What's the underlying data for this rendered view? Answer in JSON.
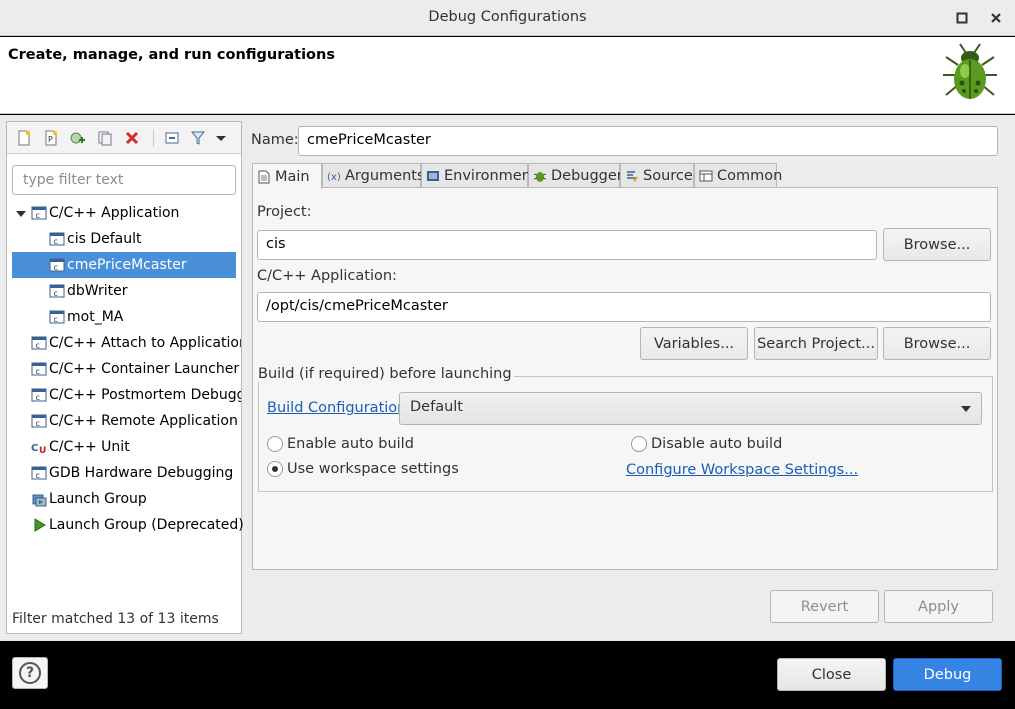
{
  "window": {
    "title": "Debug Configurations",
    "maximize_icon": "maximize-icon",
    "close_icon": "close-icon"
  },
  "header": {
    "heading": "Create, manage, and run configurations",
    "logo_icon": "bug-icon"
  },
  "left": {
    "filter_placeholder": "type filter text",
    "tree": [
      {
        "label": "C/C++ Application",
        "level": 0,
        "expanded": true,
        "icon": "c-app-icon"
      },
      {
        "label": "cis Default",
        "level": 1,
        "icon": "c-app-icon"
      },
      {
        "label": "cmePriceMcaster",
        "level": 1,
        "icon": "c-app-icon",
        "selected": true
      },
      {
        "label": "dbWriter",
        "level": 1,
        "icon": "c-app-icon"
      },
      {
        "label": "mot_MA",
        "level": 1,
        "icon": "c-app-icon"
      },
      {
        "label": "C/C++ Attach to Application",
        "level": 0,
        "icon": "c-app-icon"
      },
      {
        "label": "C/C++ Container Launcher",
        "level": 0,
        "icon": "c-app-icon"
      },
      {
        "label": "C/C++ Postmortem Debugger",
        "level": 0,
        "icon": "c-app-icon"
      },
      {
        "label": "C/C++ Remote Application",
        "level": 0,
        "icon": "c-app-icon"
      },
      {
        "label": "C/C++ Unit",
        "level": 0,
        "icon": "c-unit-icon"
      },
      {
        "label": "GDB Hardware Debugging",
        "level": 0,
        "icon": "c-app-icon"
      },
      {
        "label": "Launch Group",
        "level": 0,
        "icon": "launch-group-icon"
      },
      {
        "label": "Launch Group (Deprecated)",
        "level": 0,
        "icon": "run-icon"
      }
    ],
    "status": "Filter matched 13 of 13 items"
  },
  "right": {
    "name_label": "Name:",
    "name_value": "cmePriceMcaster",
    "tabs": [
      "Main",
      "Arguments",
      "Environment",
      "Debugger",
      "Source",
      "Common"
    ],
    "project_label": "Project:",
    "project_value": "cis",
    "browse_label": "Browse...",
    "app_label": "C/C++ Application:",
    "app_value": "/opt/cis/cmePriceMcaster",
    "variables_label": "Variables...",
    "search_project_label": "Search Project...",
    "build_group_title": "Build (if required) before launching",
    "build_config_link": "Build Configuration:",
    "build_config_value": "Default",
    "enable_auto_build": "Enable auto build",
    "disable_auto_build": "Disable auto build",
    "use_workspace": "Use workspace settings",
    "configure_workspace_link": "Configure Workspace Settings...",
    "revert_label": "Revert",
    "apply_label": "Apply"
  },
  "footer": {
    "close_label": "Close",
    "debug_label": "Debug",
    "help_icon": "help-icon"
  },
  "colors": {
    "selection": "#4a90d9",
    "primary_button": "#3584e4",
    "link": "#1a5fb4"
  }
}
